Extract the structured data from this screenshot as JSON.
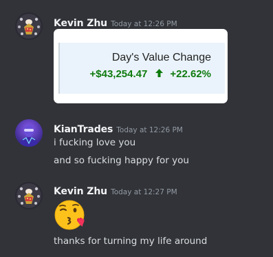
{
  "messages": [
    {
      "author": "Kevin Zhu",
      "timestamp": "Today at 12:26 PM",
      "embed": {
        "title": "Day's Value Change",
        "value_change": "+$43,254.47",
        "percent_change": "+22.62%"
      }
    },
    {
      "author": "KianTrades",
      "timestamp": "Today at 12:26 PM",
      "lines": [
        "i fucking love you",
        "and so fucking happy for you"
      ]
    },
    {
      "author": "Kevin Zhu",
      "timestamp": "Today at 12:27 PM",
      "emoji": "face-blowing-a-kiss-icon",
      "lines": [
        "thanks for turning my life around"
      ]
    }
  ],
  "colors": {
    "background": "#313338",
    "author": "#f2f3f5",
    "timestamp": "#949ba4",
    "text": "#dbdee1",
    "gain_green": "#0e7a0d"
  }
}
